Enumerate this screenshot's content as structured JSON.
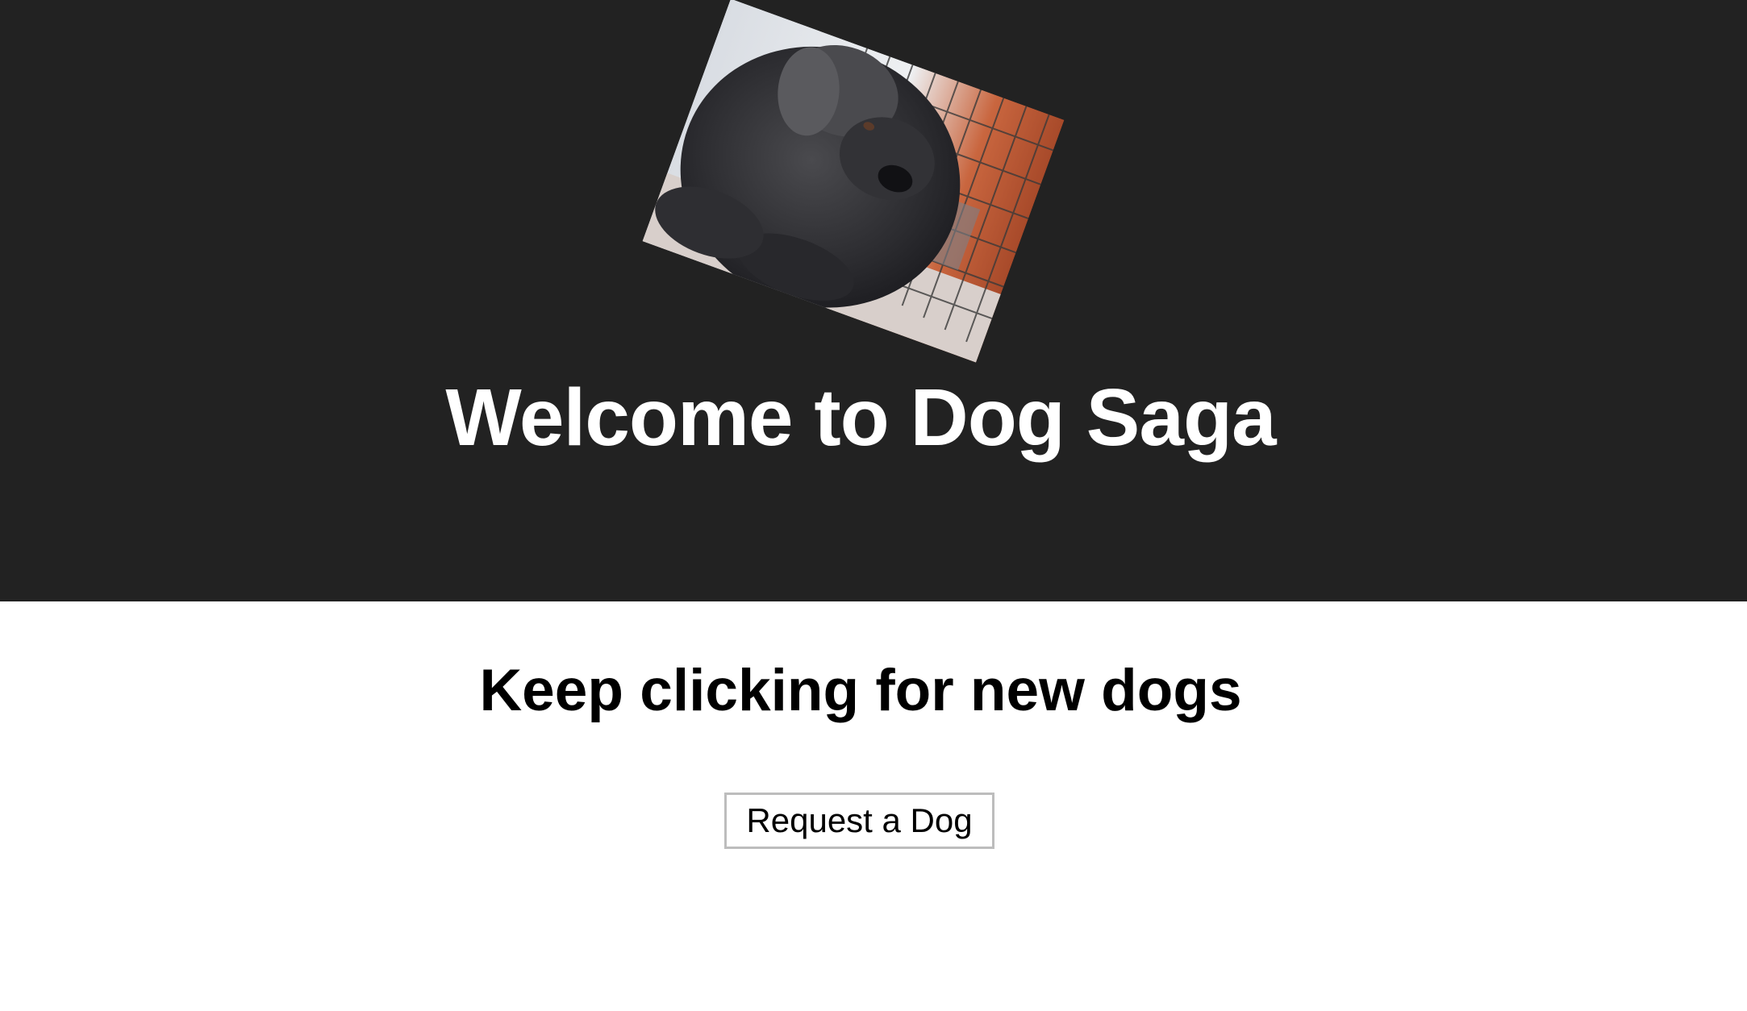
{
  "header": {
    "title": "Welcome to Dog Saga",
    "background_color": "#222222",
    "image": {
      "icon": "dog-photo"
    }
  },
  "main": {
    "subtitle": "Keep clicking for new dogs",
    "request_button_label": "Request a Dog"
  }
}
